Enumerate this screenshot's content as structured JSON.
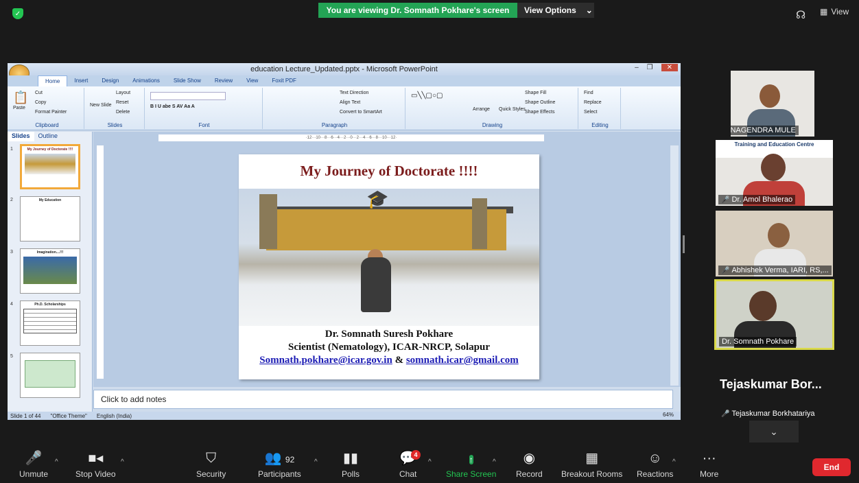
{
  "top": {
    "viewing_banner": "You are viewing Dr. Somnath Pokhare's screen",
    "view_options": "View Options",
    "view_label": "View"
  },
  "ppt": {
    "window_title": "education Lecture_Updated.pptx - Microsoft PowerPoint",
    "tabs": [
      "Home",
      "Insert",
      "Design",
      "Animations",
      "Slide Show",
      "Review",
      "View",
      "Foxit PDF"
    ],
    "groups": {
      "clipboard": "Clipboard",
      "slides": "Slides",
      "font": "Font",
      "paragraph": "Paragraph",
      "drawing": "Drawing",
      "editing": "Editing"
    },
    "ribbon_items": {
      "cut": "Cut",
      "copy": "Copy",
      "paste": "Paste",
      "format_painter": "Format Painter",
      "layout": "Layout",
      "reset": "Reset",
      "new_slide": "New Slide",
      "delete": "Delete",
      "text_direction": "Text Direction",
      "align_text": "Align Text",
      "convert_smartart": "Convert to SmartArt",
      "shape_fill": "Shape Fill",
      "shape_outline": "Shape Outline",
      "shape_effects": "Shape Effects",
      "arrange": "Arrange",
      "quick_styles": "Quick Styles",
      "find": "Find",
      "replace": "Replace",
      "select": "Select"
    },
    "pane_tabs": [
      "Slides",
      "Outline"
    ],
    "thumbs": [
      {
        "num": "1",
        "title": "My Journey of Doctorate !!!!"
      },
      {
        "num": "2",
        "title": "My Education"
      },
      {
        "num": "3",
        "title": "Imagination....!!!"
      },
      {
        "num": "4",
        "title": "Ph.D. Scholarships"
      },
      {
        "num": "5",
        "title": ""
      }
    ],
    "ruler": "·12···10···8···6···4···2···0···2···4···6···8···10···12·",
    "slide": {
      "title": "My Journey of Doctorate !!!!",
      "name": "Dr. Somnath Suresh Pokhare",
      "role": "Scientist (Nematology), ICAR-NRCP, Solapur",
      "email1": "Somnath.pokhare@icar.gov.in",
      "amp": " & ",
      "email2": "somnath.icar@gmail.com"
    },
    "notes_placeholder": "Click to add notes",
    "status": {
      "slide_count": "Slide 1 of 44",
      "theme": "\"Office Theme\"",
      "language": "English (India)",
      "zoom": "64%"
    }
  },
  "gallery": [
    {
      "name": "NAGENDRA MULE",
      "muted": true
    },
    {
      "name": "Dr. Amol Bhalerao",
      "muted": true,
      "banner": "Training and Education Centre"
    },
    {
      "name": "Abhishek Verma, IARI, RS,...",
      "muted": true
    },
    {
      "name": "Dr. Somnath Pokhare",
      "muted": false
    },
    {
      "name": "Tejaskumar Borkhatariya",
      "muted": true,
      "display": "Tejaskumar  Bor..."
    }
  ],
  "toolbar": {
    "unmute": "Unmute",
    "stop_video": "Stop Video",
    "security": "Security",
    "participants": "Participants",
    "participants_count": "92",
    "polls": "Polls",
    "chat": "Chat",
    "chat_badge": "4",
    "share_screen": "Share Screen",
    "record": "Record",
    "breakout": "Breakout Rooms",
    "reactions": "Reactions",
    "more": "More",
    "end": "End"
  },
  "colors": {
    "share_green": "#23a455",
    "end_red": "#e0282e",
    "slide_title": "#7b1c1c",
    "active_speaker": "#d9d94a"
  }
}
